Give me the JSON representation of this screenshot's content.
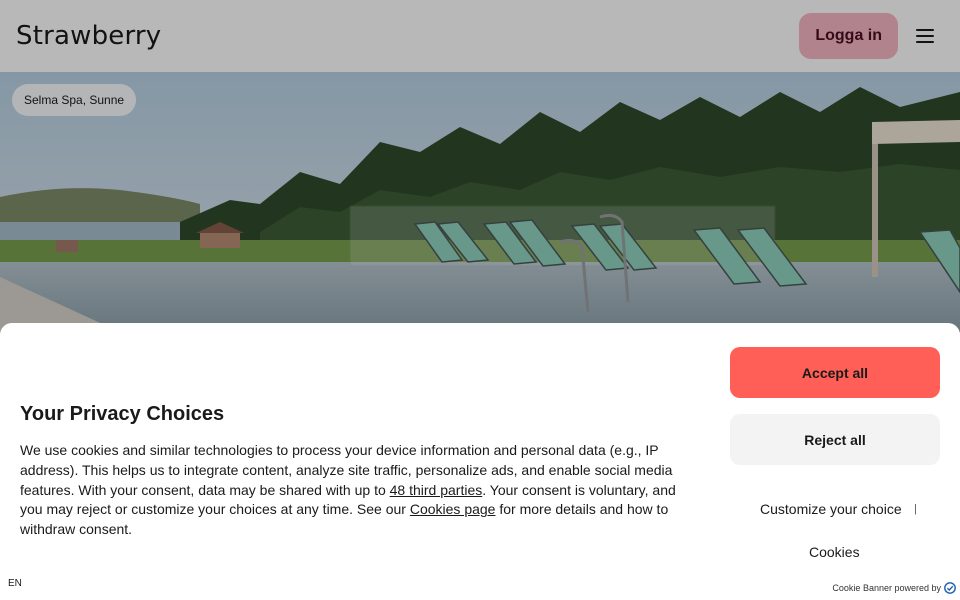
{
  "header": {
    "logo": "Strawberry",
    "login_label": "Logga in",
    "menu_icon": "hamburger-menu-icon"
  },
  "hero": {
    "location": "Selma Spa, Sunne"
  },
  "banner": {
    "title": "Your Privacy Choices",
    "text_part1": "We use cookies and similar technologies to process your device information and personal data (e.g., IP address). This helps us to integrate content, analyze site traffic, personalize ads, and enable social media features. With your consent, data may be shared with up to ",
    "third_parties_link": "48 third parties",
    "text_part2": ". Your consent is voluntary, and you may reject or customize your choices at any time. See our ",
    "cookies_page_link": "Cookies page",
    "text_part3": " for more details and how to withdraw consent.",
    "accept_label": "Accept all",
    "reject_label": "Reject all",
    "customize_label": "Customize your choice",
    "separator": "|",
    "cookies_label": "Cookies",
    "language": "EN",
    "powered_by": "Cookie Banner powered by",
    "accept_color": "#ff5f57"
  }
}
